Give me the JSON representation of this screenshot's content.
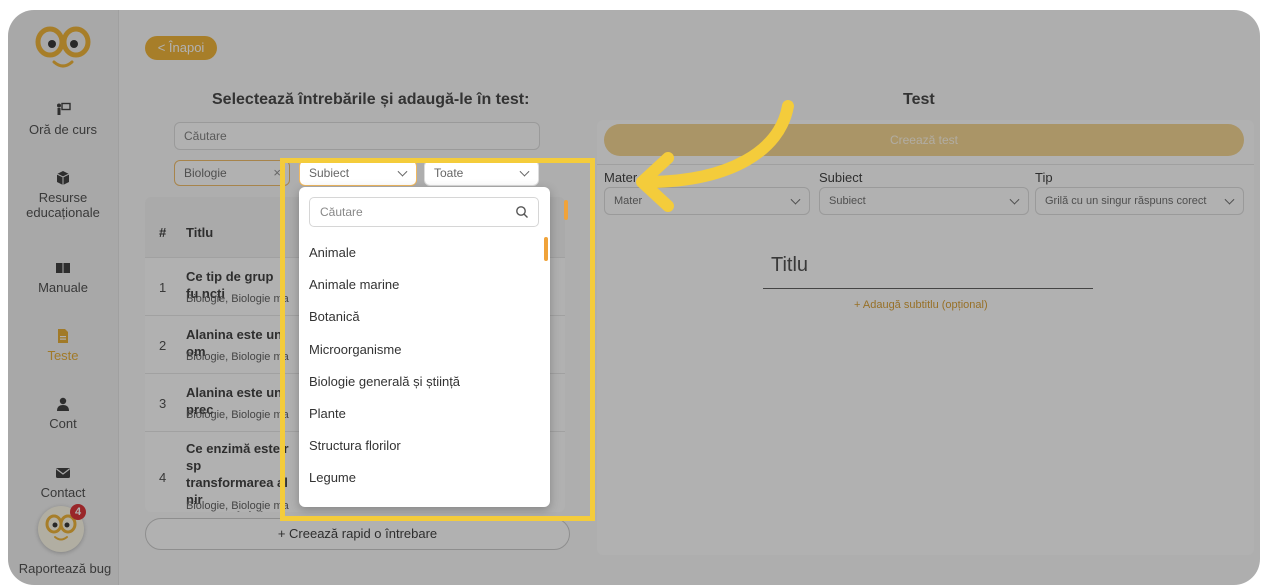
{
  "colors": {
    "accent": "#f0b02b",
    "highlight": "#f4cc3b",
    "teste_active": "#e7a92a",
    "badge": "#d9262b"
  },
  "sidebar": {
    "items": [
      {
        "label": "Oră de curs",
        "icon": "teacher-board-icon"
      },
      {
        "label": "Resurse\neducaționale",
        "icon": "box-icon"
      },
      {
        "label": "Manuale",
        "icon": "book-icon"
      },
      {
        "label": "Teste",
        "icon": "document-icon",
        "active": true
      },
      {
        "label": "Cont",
        "icon": "user-icon"
      },
      {
        "label": "Contact",
        "icon": "envelope-icon"
      }
    ],
    "bug": {
      "label": "Raportează bug",
      "badge": "4"
    }
  },
  "header": {
    "back_label": "< Înapoi"
  },
  "left": {
    "title": "Selectează întrebările și adaugă-le în test:",
    "search_placeholder": "Căutare",
    "filters": {
      "materie": "Biologie",
      "subiect": "Subiect",
      "tip": "Toate"
    },
    "table": {
      "headers": {
        "num": "#",
        "title": "Titlu"
      },
      "rows": [
        {
          "num": "1",
          "question": "Ce tip de grup fu ncți",
          "meta": "Biologie, Biologie ma"
        },
        {
          "num": "2",
          "question": "Alanina este un om",
          "meta": "Biologie, Biologie ma"
        },
        {
          "num": "3",
          "question": "Alanina este un prec",
          "meta": "Biologie, Biologie ma"
        },
        {
          "num": "4",
          "question": "Ce enzimă este r sp\ntransformarea al nir\nprocesului de gl cor",
          "meta": "Biologie, Biologie ma"
        }
      ]
    },
    "quick_create_label": "+ Creează rapid o întrebare"
  },
  "right": {
    "title": "Test",
    "create_label": "Creează test",
    "fields": {
      "materie_label": "Mater",
      "materie_value": "Mater",
      "subiect_label": "Subiect",
      "subiect_value": "Subiect",
      "tip_label": "Tip",
      "tip_value": "Grilă cu un singur răspuns corect"
    },
    "title_placeholder": "Titlu",
    "subtitle_add": "+ Adaugă subtitlu (opțional)"
  },
  "dropdown": {
    "search_placeholder": "Căutare",
    "options": [
      "Animale",
      "Animale marine",
      "Botanică",
      "Microorganisme",
      "Biologie generală și știință",
      "Plante",
      "Structura florilor",
      "Legume"
    ]
  }
}
